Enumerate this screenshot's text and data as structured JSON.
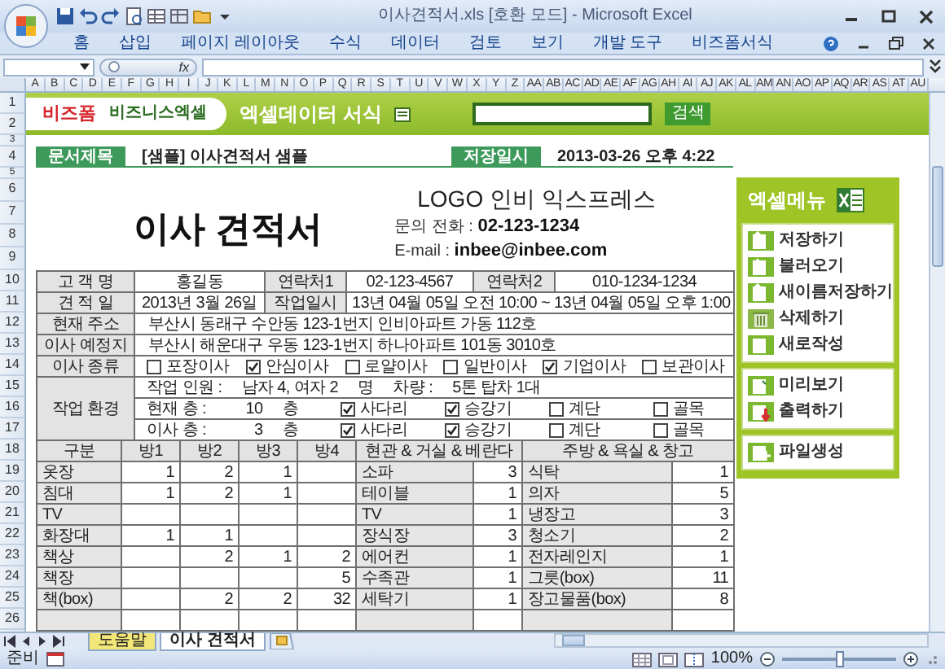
{
  "window": {
    "title": "이사견적서.xls  [호환 모드] - Microsoft Excel"
  },
  "ribbon_tabs": [
    "홈",
    "삽입",
    "페이지 레이아웃",
    "수식",
    "데이터",
    "검토",
    "보기",
    "개발 도구",
    "비즈폼서식"
  ],
  "formula_bar": {
    "function_label": "fx"
  },
  "column_headers": [
    "A",
    "B",
    "C",
    "D",
    "E",
    "F",
    "G",
    "H",
    "I",
    "J",
    "K",
    "L",
    "M",
    "N",
    "O",
    "P",
    "Q",
    "R",
    "S",
    "T",
    "U",
    "V",
    "W",
    "X",
    "Y",
    "Z",
    "AA",
    "AB",
    "AC",
    "AD",
    "AE",
    "AF",
    "AG",
    "AH",
    "AI",
    "AJ",
    "AK",
    "AL",
    "AM",
    "AN",
    "AO",
    "AP",
    "AQ",
    "AR",
    "AS",
    "AT",
    "AU"
  ],
  "row_headers": [
    "1",
    "2",
    "3",
    "4",
    "5",
    "6",
    "7",
    "8",
    "9",
    "10",
    "11",
    "12",
    "13",
    "14",
    "15",
    "16",
    "17",
    "18",
    "19",
    "20",
    "21",
    "22",
    "23",
    "24",
    "25",
    "26"
  ],
  "banner": {
    "brand": "비즈폼",
    "product": "비즈니스엑셀",
    "title": "엑셀데이터 서식",
    "search_button": "검색"
  },
  "document": {
    "title_label": "문서제목",
    "title": "[샘플] 이사견적서 샘플",
    "saved_label": "저장일시",
    "saved": "2013-03-26  오후 4:22"
  },
  "heading": "이사 견적서",
  "company": {
    "name": "LOGO  인비 익스프레스",
    "phone_line": "문의 전화  :  **02-123-1234**",
    "email_line": "E-mail  :  **inbee@inbee.com**"
  },
  "info_rows": [
    {
      "cells": [
        {
          "kind": "label",
          "text": "고 객 명"
        },
        {
          "kind": "value",
          "text": "홍길동"
        },
        {
          "kind": "label",
          "text": "연락처1"
        },
        {
          "kind": "value",
          "text": "02-123-4567"
        },
        {
          "kind": "label",
          "text": "연락처2"
        },
        {
          "kind": "value",
          "text": "010-1234-1234"
        }
      ]
    },
    {
      "cells": [
        {
          "kind": "label",
          "text": "견 적 일"
        },
        {
          "kind": "value",
          "text": "2013년 3월 26일"
        },
        {
          "kind": "label",
          "text": "작업일시"
        },
        {
          "kind": "value",
          "text": "13년 04월 05일 오전 10:00  ~  13년 04월 05일 오후 1:00"
        }
      ]
    },
    {
      "cells": [
        {
          "kind": "label",
          "text": "현재 주소"
        },
        {
          "kind": "value",
          "text": "부산시 동래구 수안동 123-1번지 인비아파트 가동 112호"
        }
      ]
    },
    {
      "cells": [
        {
          "kind": "label",
          "text": "이사 예정지"
        },
        {
          "kind": "value",
          "text": "부산시 해운대구 우동 123-1번지 하나아파트 101동 3010호"
        }
      ]
    }
  ],
  "move_types": {
    "label": "이사 종류",
    "options": [
      {
        "label": "포장이사",
        "checked": false
      },
      {
        "label": "안심이사",
        "checked": true
      },
      {
        "label": "로얄이사",
        "checked": false
      },
      {
        "label": "일반이사",
        "checked": false
      },
      {
        "label": "기업이사",
        "checked": true
      },
      {
        "label": "보관이사",
        "checked": false
      }
    ]
  },
  "work_env": {
    "label": "작업 환경",
    "staff_label": "작업 인원 :",
    "staff": "남자 4, 여자 2",
    "staff_unit": "명",
    "vehicle_label": "차량 :",
    "vehicle": "5톤 탑차 1대",
    "floors": [
      {
        "label": "현재 층 :",
        "value": "10",
        "unit": "층",
        "options": [
          {
            "label": "사다리",
            "checked": true
          },
          {
            "label": "승강기",
            "checked": true
          },
          {
            "label": "계단",
            "checked": false
          },
          {
            "label": "골목",
            "checked": false
          }
        ]
      },
      {
        "label": "이사 층 :",
        "value": "3",
        "unit": "층",
        "options": [
          {
            "label": "사다리",
            "checked": true
          },
          {
            "label": "승강기",
            "checked": true
          },
          {
            "label": "계단",
            "checked": false
          },
          {
            "label": "골목",
            "checked": false
          }
        ]
      }
    ]
  },
  "inventory": {
    "columns": [
      "구분",
      "방1",
      "방2",
      "방3",
      "방4",
      "현관 & 거실 & 베란다",
      "주방 & 욕실 & 창고"
    ],
    "rows": [
      {
        "item": "옷장",
        "room_1": "1",
        "room_2": "2",
        "room_3": "1",
        "living_item": "소파",
        "living_count": "3",
        "kitchen_item": "식탁",
        "kitchen_count": "1"
      },
      {
        "item": "침대",
        "room_1": "1",
        "room_2": "2",
        "room_3": "1",
        "living_item": "테이블",
        "living_count": "1",
        "kitchen_item": "의자",
        "kitchen_count": "5"
      },
      {
        "item": "TV",
        "living_item": "TV",
        "living_count": "1",
        "kitchen_item": "냉장고",
        "kitchen_count": "3"
      },
      {
        "item": "화장대",
        "room_1": "1",
        "room_2": "1",
        "living_item": "장식장",
        "living_count": "3",
        "kitchen_item": "청소기",
        "kitchen_count": "2"
      },
      {
        "item": "책상",
        "room_2": "2",
        "room_3": "1",
        "room_4": "2",
        "living_item": "에어컨",
        "living_count": "1",
        "kitchen_item": "전자레인지",
        "kitchen_count": "1"
      },
      {
        "item": "책장",
        "room_4": "5",
        "living_item": "수족관",
        "living_count": "1",
        "kitchen_item": "그릇(box)",
        "kitchen_count": "11"
      },
      {
        "item": "책(box)",
        "room_2": "2",
        "room_3": "2",
        "room_4": "32",
        "living_item": "세탁기",
        "living_count": "1",
        "kitchen_item": "장고물품(box)",
        "kitchen_count": "8"
      }
    ]
  },
  "side_menu": {
    "title": "엑셀메뉴",
    "groups": [
      [
        {
          "label": "저장하기",
          "kind": "upload"
        },
        {
          "label": "불러오기",
          "kind": "download"
        },
        {
          "label": "새이름저장하기",
          "kind": "upload"
        },
        {
          "label": "삭제하기",
          "kind": "trash"
        },
        {
          "label": "새로작성",
          "kind": "blank"
        }
      ],
      [
        {
          "label": "미리보기",
          "kind": "preview"
        },
        {
          "label": "출력하기",
          "kind": "print"
        }
      ],
      [
        {
          "label": "파일생성",
          "kind": "create"
        }
      ]
    ]
  },
  "sheet_tabs": [
    {
      "label": "도움말",
      "selected": false,
      "color": "#f3e77a"
    },
    {
      "label": "이사 견적서",
      "selected": true
    }
  ],
  "status_bar": {
    "text": "준비",
    "zoom": "100%",
    "zoom_slider": {
      "level": 0.5
    }
  }
}
